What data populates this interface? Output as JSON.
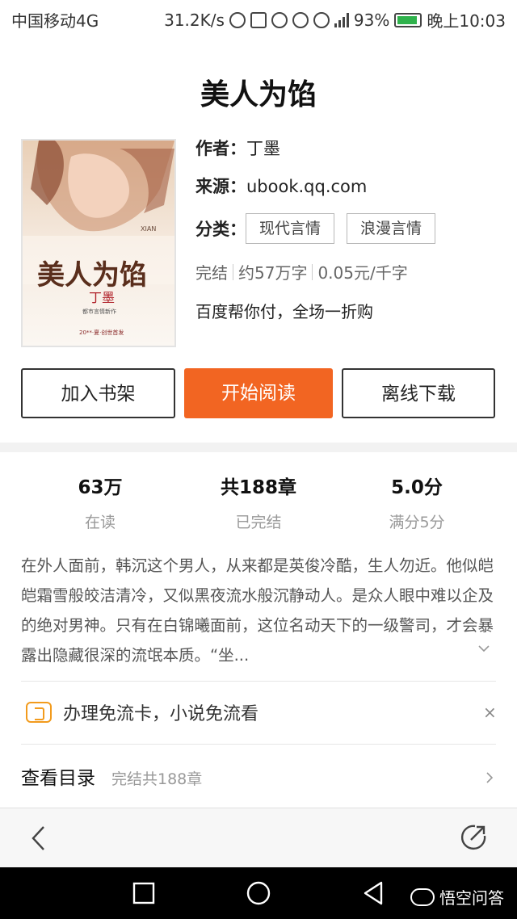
{
  "status_bar": {
    "carrier": "中国移动4G",
    "speed": "31.2K/s",
    "network": "4G",
    "battery": "93%",
    "time": "晚上10:03"
  },
  "book": {
    "title": "美人为馅",
    "author_label": "作者：",
    "author": "丁墨",
    "source_label": "来源：",
    "source": "ubook.qq.com",
    "category_label": "分类：",
    "categories": [
      "现代言情",
      "浪漫言情"
    ],
    "meta": [
      "完结",
      "约57万字",
      "0.05元/千字"
    ],
    "promo": "百度帮你付，全场一折购",
    "cover": {
      "title_text": "美人为馅",
      "author_text": "丁墨",
      "latin_text": "XIAN",
      "series_text": "都市言情新作",
      "footer_text": "20**·夏·创世首发"
    }
  },
  "actions": {
    "add_shelf": "加入书架",
    "start_read": "开始阅读",
    "download": "离线下载"
  },
  "stats": [
    {
      "value": "63万",
      "label": "在读"
    },
    {
      "value": "共188章",
      "label": "已完结"
    },
    {
      "value": "5.0分",
      "label": "满分5分"
    }
  ],
  "description": "在外人面前，韩沉这个男人，从来都是英俊冷酷，生人勿近。他似皑皑霜雪般皎洁清冷，又似黑夜流水般沉静动人。是众人眼中难以企及的绝对男神。只有在白锦曦面前，这位名动天下的一级警司，才会暴露出隐藏很深的流氓本质。“坐...",
  "ad": {
    "text": "办理免流卡，小说免流看",
    "close": "×"
  },
  "toc": {
    "title": "查看目录",
    "subtitle": "完结共188章"
  },
  "watermark": "悟空问答",
  "colors": {
    "accent": "#f26522",
    "ad_icon": "#f29b1d"
  }
}
